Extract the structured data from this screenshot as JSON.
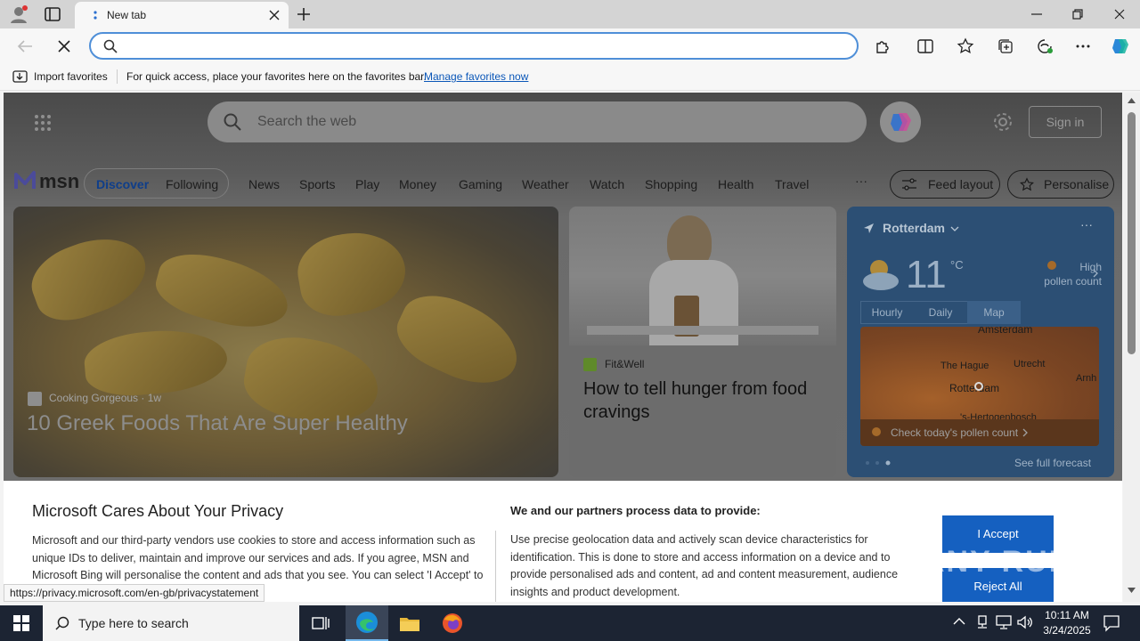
{
  "browser": {
    "tab_title": "New tab",
    "address_value": "",
    "favorites_bar": {
      "import_label": "Import favorites",
      "hint": "For quick access, place your favorites here on the favorites bar.",
      "manage_link": "Manage favorites now"
    },
    "status_url": "https://privacy.microsoft.com/en-gb/privacystatement"
  },
  "msn": {
    "search_placeholder": "Search the web",
    "sign_in": "Sign in",
    "logo_text": "msn",
    "tabs": [
      "Discover",
      "Following"
    ],
    "nav": [
      "News",
      "Sports",
      "Play",
      "Money",
      "Gaming",
      "Weather",
      "Watch",
      "Shopping",
      "Health",
      "Travel"
    ],
    "more": "···",
    "feed_layout": "Feed layout",
    "personalise": "Personalise"
  },
  "hero": {
    "source": "Cooking Gorgeous",
    "age": "1w",
    "title": "10 Greek Foods That Are Super Healthy"
  },
  "card2": {
    "source": "Fit&Well",
    "title": "How to tell hunger from food cravings"
  },
  "weather": {
    "city": "Rotterdam",
    "temp": "11",
    "unit": "°C",
    "pollen_line1": "High",
    "pollen_line2": "pollen count",
    "tabs": [
      "Hourly",
      "Daily",
      "Map"
    ],
    "map_labels": [
      "Amsterdam",
      "The Hague",
      "Utrecht",
      "Rotterdam",
      "Arnh",
      "'s-Hertogenbosch"
    ],
    "check_pollen": "Check today's pollen count",
    "full_forecast": "See full forecast",
    "more": "···"
  },
  "privacy": {
    "title": "Microsoft Cares About Your Privacy",
    "text": "Microsoft and our third-party vendors use cookies to store and access information such as unique IDs to deliver, maintain and improve our services and ads. If you agree, MSN and Microsoft Bing will personalise the content and ads that you see. You can select 'I Accept' to consent or click on 'Manage preferences' to",
    "heading2": "We and our partners process data to provide:",
    "text2": "Use precise geolocation data and actively scan device characteristics for identification. This is done to store and access information on a device and to provide personalised ads and content, ad and content measurement, audience insights and product development.",
    "accept": "I Accept",
    "reject": "Reject All"
  },
  "watermark": "ANY RUN",
  "taskbar": {
    "search_placeholder": "Type here to search",
    "time": "10:11 AM",
    "date": "3/24/2025"
  },
  "colors": {
    "accent": "#1560c0",
    "taskbar": "#1c2433",
    "weather_bg": "#2c4f74"
  }
}
